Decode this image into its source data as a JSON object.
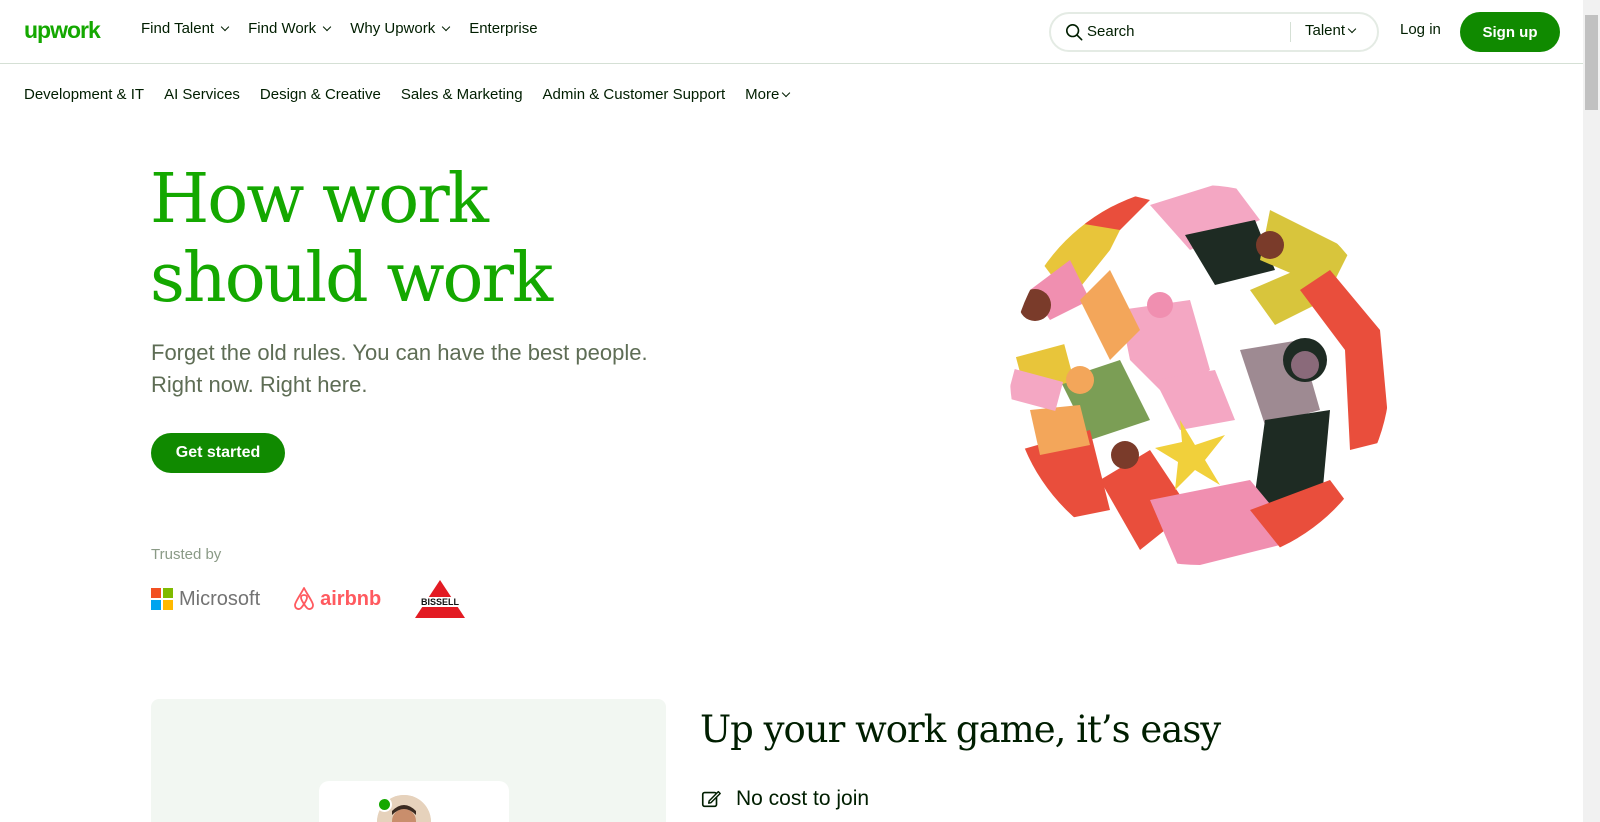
{
  "colors": {
    "brand": "#14a800",
    "button": "#108a00",
    "text": "#001e00",
    "muted": "#5e6d55"
  },
  "header": {
    "logo": "upwork",
    "nav": [
      {
        "label": "Find Talent",
        "dropdown": true
      },
      {
        "label": "Find Work",
        "dropdown": true
      },
      {
        "label": "Why Upwork",
        "dropdown": true
      },
      {
        "label": "Enterprise",
        "dropdown": false
      }
    ],
    "search": {
      "placeholder": "Search",
      "scope": "Talent"
    },
    "login": "Log in",
    "signup": "Sign up"
  },
  "categories": [
    "Development & IT",
    "AI Services",
    "Design & Creative",
    "Sales & Marketing",
    "Admin & Customer Support"
  ],
  "categories_more": "More",
  "hero": {
    "title_line1": "How work",
    "title_line2": "should work",
    "subtitle": "Forget the old rules. You can have the best people. Right now. Right here.",
    "cta": "Get started",
    "trusted_label": "Trusted by",
    "logos": {
      "microsoft": "Microsoft",
      "airbnb": "airbnb",
      "bissell": "BISSELL"
    }
  },
  "section": {
    "title": "Up your work game, it’s easy",
    "feature_1": "No cost to join",
    "feature_1_icon": "edit-icon"
  }
}
